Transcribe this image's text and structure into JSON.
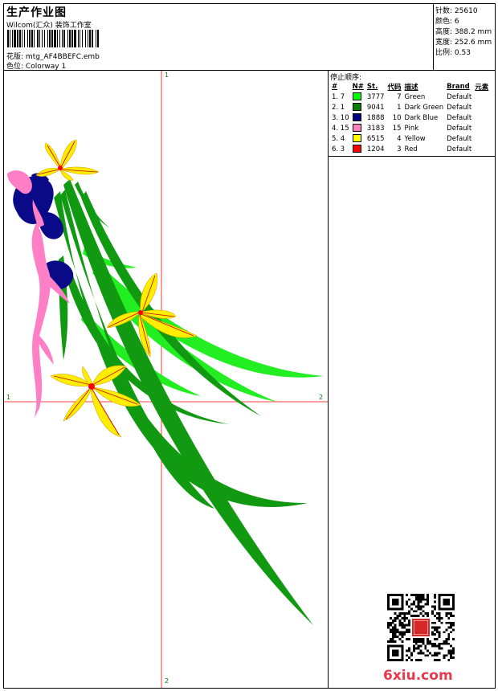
{
  "header": {
    "title": "生产作业图",
    "company": "Wilcom(汇众) 装饰工作室",
    "design_label": "花版:",
    "design_file": "mtg_AF4BBEFC.emb",
    "colorway_label": "色位:",
    "colorway": "Colorway 1"
  },
  "stats": [
    {
      "label": "针数:",
      "value": "25610"
    },
    {
      "label": "颜色:",
      "value": "6"
    },
    {
      "label": "高度:",
      "value": "388.2 mm"
    },
    {
      "label": "宽度:",
      "value": "252.6 mm"
    },
    {
      "label": "比例:",
      "value": "0.53"
    }
  ],
  "stop_sequence": {
    "title": "停止顺序:",
    "headers": [
      "#",
      "N#",
      "St.",
      "代码",
      "描述",
      "Brand",
      "元素"
    ],
    "rows": [
      {
        "seq": "1. 7",
        "stitches": "3777",
        "code": "7",
        "desc": "Green",
        "brand": "Default",
        "color": "#00ff00"
      },
      {
        "seq": "2. 1",
        "stitches": "9041",
        "code": "1",
        "desc": "Dark Green",
        "brand": "Default",
        "color": "#008000"
      },
      {
        "seq": "3. 10",
        "stitches": "1888",
        "code": "10",
        "desc": "Dark Blue",
        "brand": "Default",
        "color": "#000080"
      },
      {
        "seq": "4. 15",
        "stitches": "3183",
        "code": "15",
        "desc": "Pink",
        "brand": "Default",
        "color": "#ff80c0"
      },
      {
        "seq": "5. 4",
        "stitches": "6515",
        "code": "4",
        "desc": "Yellow",
        "brand": "Default",
        "color": "#ffff00"
      },
      {
        "seq": "6. 3",
        "stitches": "1204",
        "code": "3",
        "desc": "Red",
        "brand": "Default",
        "color": "#ff0000"
      }
    ]
  },
  "axis_labels": {
    "top": "1",
    "bottom": "2",
    "left": "1",
    "right": "2"
  },
  "watermark": {
    "site": "6xiu.com",
    "seal": "以绣会友"
  }
}
